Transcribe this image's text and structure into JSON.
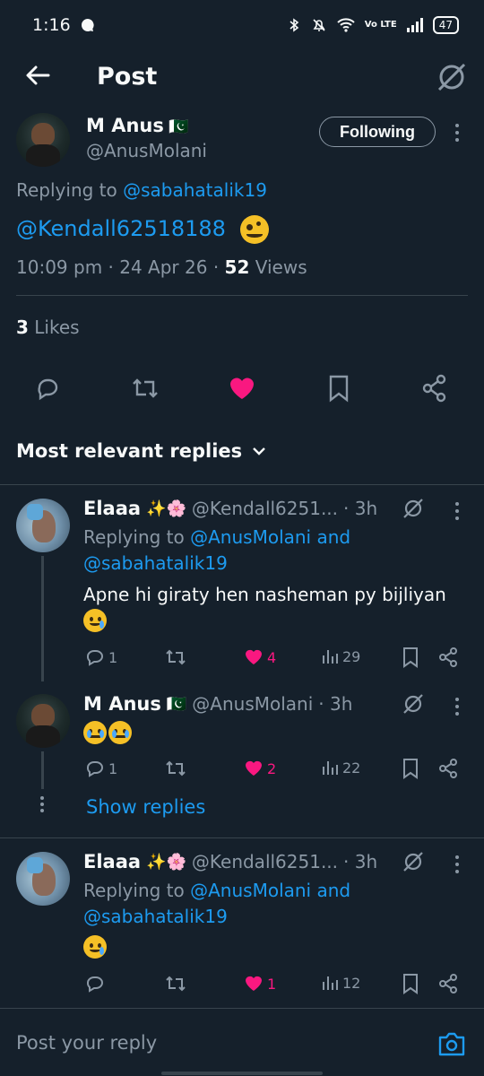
{
  "status_bar": {
    "time": "1:16",
    "network": "Vo LTE",
    "battery": "47"
  },
  "header": {
    "title": "Post"
  },
  "post": {
    "author_name": "M Anus",
    "author_flag": "🇵🇰",
    "author_handle": "@AnusMolani",
    "follow_label": "Following",
    "replying_to_prefix": "Replying to",
    "replying_to_handle": "@sabahatalik19",
    "body_mention": "@Kendall62518188",
    "timestamp": "10:09 pm · 24 Apr 26 ·",
    "views_count": "52",
    "views_label": "Views",
    "likes_count": "3",
    "likes_label": "Likes"
  },
  "sort": {
    "label": "Most relevant replies"
  },
  "replies": [
    {
      "name": "Elaaa",
      "name_emoji": "✨🌸",
      "handle": "@Kendall6251...",
      "time": "· 3h",
      "replying_prefix": "Replying to",
      "replying_line1": "@AnusMolani and",
      "replying_line2": "@sabahatalik19",
      "text": "Apne hi giraty hen nasheman py bijliyan",
      "replies_count": "1",
      "likes_count": "4",
      "views_count": "29"
    },
    {
      "name": "M Anus",
      "name_emoji": "🇵🇰",
      "handle": "@AnusMolani",
      "time": "· 3h",
      "replies_count": "1",
      "likes_count": "2",
      "views_count": "22",
      "show_replies": "Show replies"
    },
    {
      "name": "Elaaa",
      "name_emoji": "✨🌸",
      "handle": "@Kendall6251...",
      "time": "· 3h",
      "replying_prefix": "Replying to",
      "replying_line1": "@AnusMolani and",
      "replying_line2": "@sabahatalik19",
      "replies_count": "",
      "likes_count": "1",
      "views_count": "12"
    }
  ],
  "composer": {
    "placeholder": "Post your reply"
  },
  "colors": {
    "background": "#15202b",
    "accent": "#1d9bf0",
    "like": "#f91880",
    "muted": "#8b98a5",
    "divider": "#38444d"
  },
  "icons": [
    "back-arrow-icon",
    "grok-icon",
    "more-icon",
    "reply-icon",
    "repost-icon",
    "heart-icon",
    "bookmark-icon",
    "share-icon",
    "views-icon",
    "camera-icon",
    "chevron-down-icon"
  ]
}
